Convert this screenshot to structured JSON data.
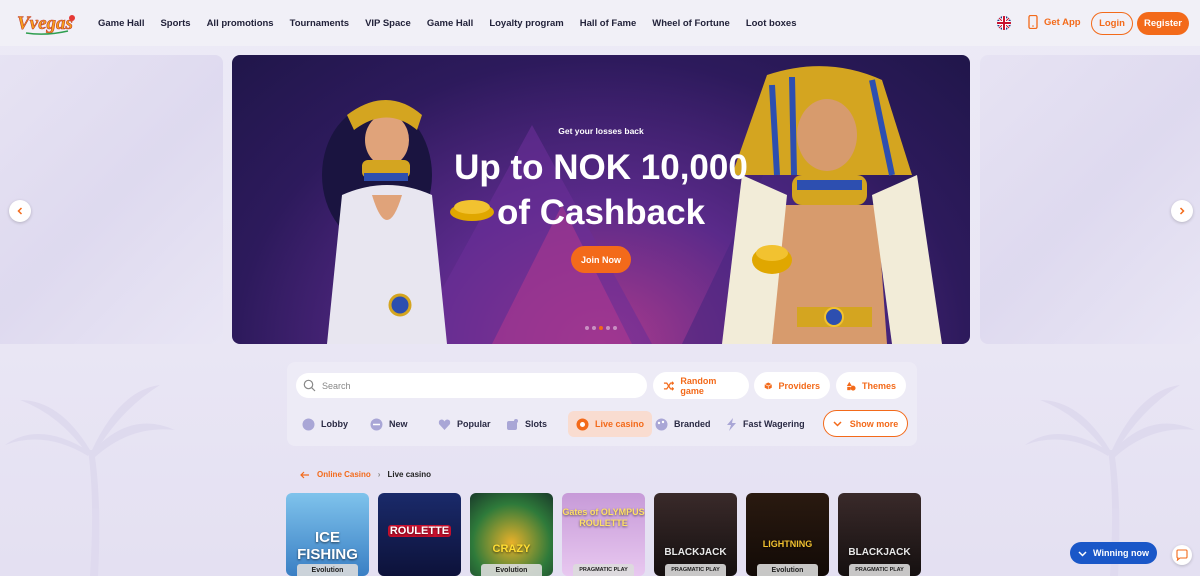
{
  "brand": {
    "logo_text": "Vvegas",
    "accent": "#f36a1a"
  },
  "nav": {
    "items": [
      "Game Hall",
      "Sports",
      "All promotions",
      "Tournaments",
      "VIP Space",
      "Game Hall",
      "Loyalty program",
      "Hall of Fame",
      "Wheel of Fortune",
      "Loot boxes"
    ]
  },
  "header": {
    "language_icon": "uk-flag-icon",
    "get_app": "Get App",
    "login": "Login",
    "register": "Register"
  },
  "hero": {
    "subtitle": "Get your losses back",
    "title_line1": "Up to NOK 10,000",
    "title_line2": "of Cashback",
    "cta": "Join Now",
    "slide_count": 5,
    "active_slide": 3
  },
  "search": {
    "placeholder": "Search"
  },
  "quick_filters": [
    "Random game",
    "Providers",
    "Themes"
  ],
  "categories": [
    "Lobby",
    "New",
    "Popular",
    "Slots",
    "Live casino",
    "Branded",
    "Fast Wagering"
  ],
  "active_category": "Live casino",
  "show_more": "Show more",
  "breadcrumb": {
    "parent": "Online Casino",
    "current": "Live casino"
  },
  "games": [
    {
      "title": "ICE FISHING",
      "provider": "Evolution"
    },
    {
      "title": "ROULETTE",
      "provider": ""
    },
    {
      "title": "CRAZY",
      "provider": "Evolution"
    },
    {
      "title": "Gates of OLYMPUS ROULETTE",
      "provider": "PRAGMATIC PLAY"
    },
    {
      "title": "BLACKJACK",
      "provider": "PRAGMATIC PLAY"
    },
    {
      "title": "LIGHTNING",
      "provider": "Evolution"
    },
    {
      "title": "BLACKJACK",
      "provider": "PRAGMATIC PLAY"
    }
  ],
  "winning_now": "Winning now"
}
